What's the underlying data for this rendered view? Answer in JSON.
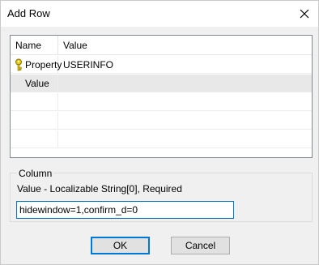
{
  "window": {
    "title": "Add Row"
  },
  "grid": {
    "columns": [
      "Name",
      "Value"
    ],
    "rows": [
      {
        "name": "Property",
        "value": "USERINFO",
        "icon": "key-icon"
      },
      {
        "name": "Value",
        "value": ""
      }
    ]
  },
  "column_group": {
    "legend": "Column",
    "description": "Value - Localizable String[0], Required",
    "input_value": "hidewindow=1,confirm_d=0"
  },
  "buttons": {
    "ok_label": "OK",
    "cancel_label": "Cancel"
  },
  "colors": {
    "accent": "#0078d7",
    "selected_row": "#e8e8e8",
    "dialog_bg": "#f0f0f0",
    "key_icon": "#d6b300"
  }
}
